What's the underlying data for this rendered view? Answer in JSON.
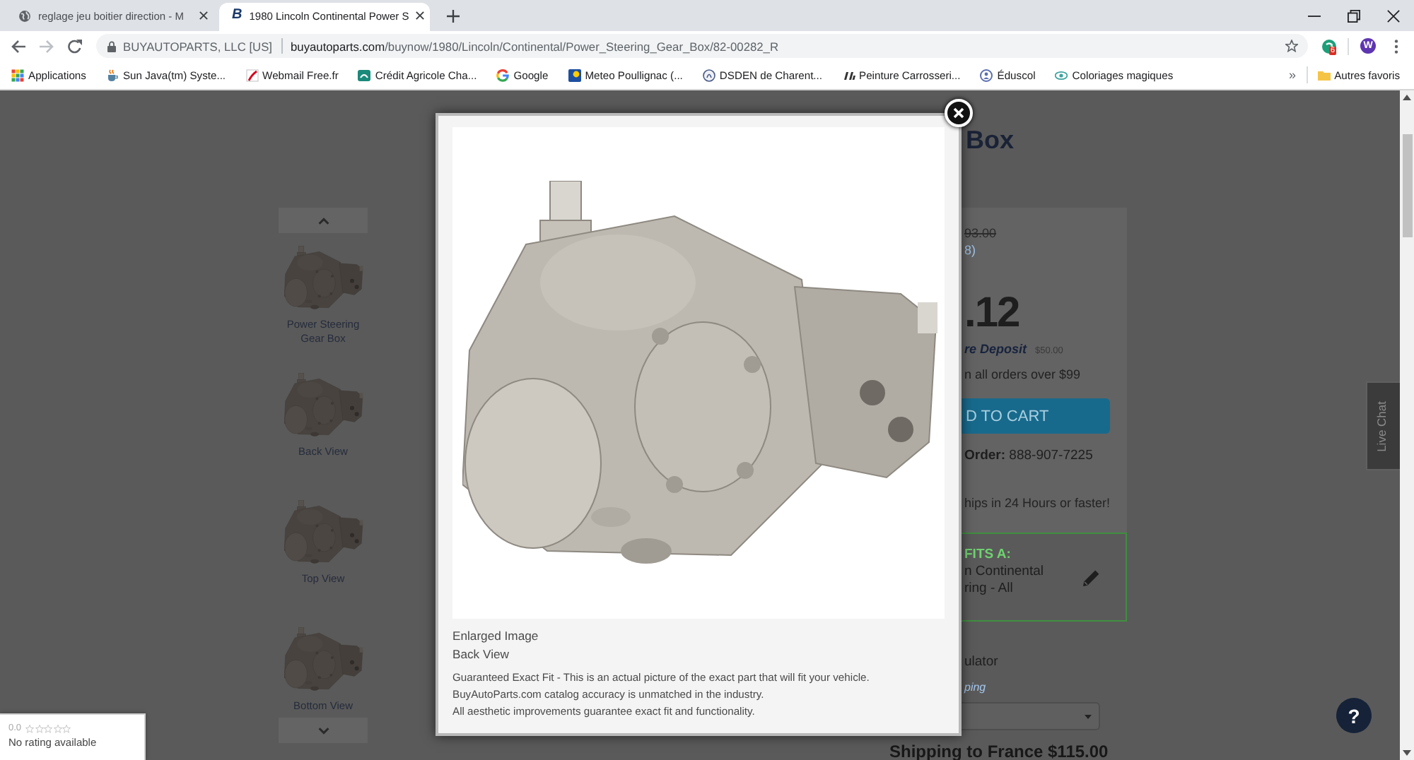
{
  "browser": {
    "tabs": [
      {
        "title": "reglage jeu boitier direction - M",
        "selected": false
      },
      {
        "title": "1980 Lincoln Continental Power S",
        "favicon_letter": "B",
        "selected": true
      }
    ],
    "address_bar": {
      "site_identity": "BUYAUTOPARTS, LLC [US]",
      "url_domain": "buyautoparts.com",
      "url_path": "/buynow/1980/Lincoln/Continental/Power_Steering_Gear_Box/82-00282_R"
    },
    "extension_badge": "6",
    "profile_initial": "W",
    "bookmarks": [
      {
        "label": "Applications"
      },
      {
        "label": "Sun Java(tm) Syste..."
      },
      {
        "label": "Webmail Free.fr"
      },
      {
        "label": "Crédit Agricole Cha..."
      },
      {
        "label": "Google"
      },
      {
        "label": "Meteo Poullignac (..."
      },
      {
        "label": "DSDEN de Charent..."
      },
      {
        "label": "Peinture Carrosseri..."
      },
      {
        "label": "Éduscol"
      },
      {
        "label": "Coloriages magiques"
      }
    ],
    "more_bookmarks": "»",
    "other_bookmarks": "Autres favoris"
  },
  "page": {
    "thumbnails": [
      {
        "caption": "Power Steering Gear Box"
      },
      {
        "caption": "Back View"
      },
      {
        "caption": "Top View"
      },
      {
        "caption": "Bottom View"
      }
    ],
    "title": "Box",
    "price_panel": {
      "old_price": "93.00",
      "savings": "8)",
      "price": ".12",
      "deposit_label": "re Deposit",
      "deposit_amount": "$50.00",
      "free_shipping": "n all orders over $99",
      "cart_button": "D TO CART",
      "phone_order": "**Order:** 888-907-7225",
      "dispatch": "hips in 24 Hours or faster!"
    },
    "fitment": {
      "heading": "FITS A:",
      "lines": [
        "n Continental",
        "ring - All"
      ]
    },
    "calculator": {
      "label": "ulator",
      "link": "ping"
    },
    "shipping": "Shipping to France $115.00",
    "live_chat": "Live Chat",
    "help": "?"
  },
  "modal": {
    "heading": "Enlarged Image",
    "view": "Back View",
    "description": [
      "Guaranteed Exact Fit - This is an actual picture of the exact part that will fit your vehicle.",
      "BuyAutoParts.com catalog accuracy is unmatched in the industry.",
      "All aesthetic improvements guarantee exact fit and functionality."
    ]
  },
  "rating_widget": {
    "score": "0.0",
    "stars": 0,
    "text": "No rating available"
  }
}
